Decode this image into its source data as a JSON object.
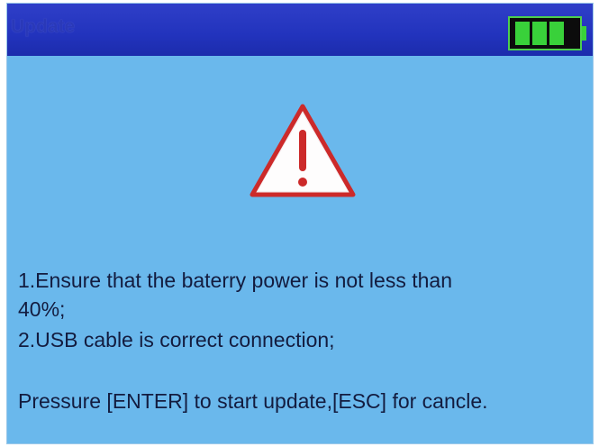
{
  "window": {
    "title": "Update"
  },
  "battery": {
    "icon": "battery-icon",
    "level_bars": 3,
    "max_bars": 3,
    "color": "#39d13a"
  },
  "warning": {
    "icon": "warning-triangle-icon",
    "color": "#cc2a2a"
  },
  "message": {
    "line1": "1.Ensure that the baterry power is not less than",
    "line2": "40%;",
    "line3": "2.USB cable is correct connection;",
    "prompt": "Pressure [ENTER] to start update,[ESC] for cancle."
  },
  "colors": {
    "background": "#6ab8ec",
    "titlebar": "#2233bd"
  }
}
